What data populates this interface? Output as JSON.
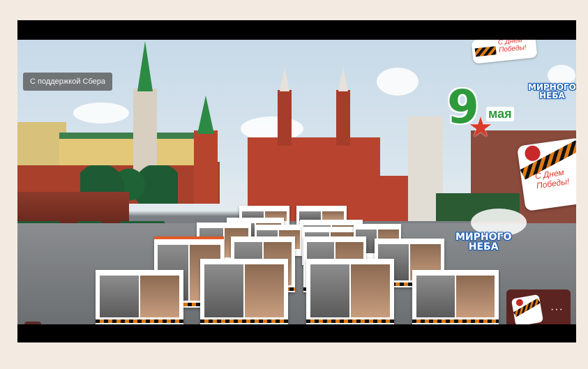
{
  "player": {
    "sponsor_label": "С поддержкой Сбера",
    "fullscreen_icon": "collapse-icon",
    "more_label": "···"
  },
  "stickers": {
    "date_number": "9",
    "date_word": "мая",
    "peace_sky_top": "МИРНОГО\nНЕБА",
    "peace_sky_mid": "МИРНОГО\nНЕБА",
    "victory_greeting": "С Днем\nПобеды!",
    "victory_top": "С Днём\nПобеды!"
  },
  "colors": {
    "brand_blue": "#1b5db4",
    "ribbon_orange": "#e07a12",
    "button_bg": "#5b2420",
    "green_nine": "#2f9a3c",
    "star_red": "#d93a2a"
  }
}
